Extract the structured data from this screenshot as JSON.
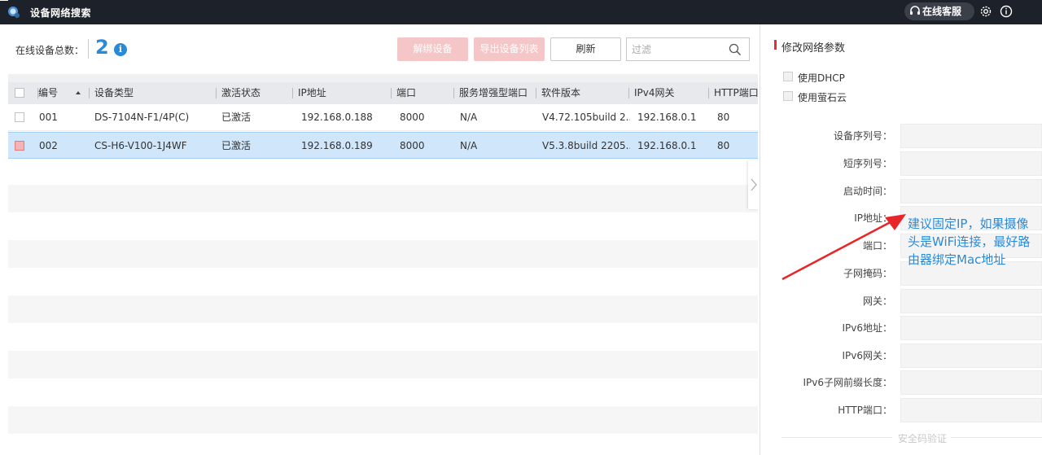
{
  "window": {
    "title": "设备网络搜索",
    "customer_service": "在线客服"
  },
  "toolbar": {
    "total_label": "在线设备总数：",
    "total_count": "2",
    "unbind_label": "解绑设备",
    "export_label": "导出设备列表",
    "refresh_label": "刷新",
    "filter_placeholder": "过滤"
  },
  "table": {
    "columns": [
      "编号",
      "设备类型",
      "激活状态",
      "IP地址",
      "端口",
      "服务增强型端口",
      "软件版本",
      "IPv4网关",
      "HTTP端口"
    ],
    "rows": [
      {
        "id": "001",
        "type": "DS-7104N-F1/4P(C)",
        "status": "已激活",
        "ip": "192.168.0.188",
        "port": "8000",
        "enhanced_port": "N/A",
        "version": "V4.72.105build 2...",
        "gateway": "192.168.0.1",
        "http_port": "80",
        "selected": false
      },
      {
        "id": "002",
        "type": "CS-H6-V100-1J4WF",
        "status": "已激活",
        "ip": "192.168.0.189",
        "port": "8000",
        "enhanced_port": "N/A",
        "version": "V5.3.8build 2205...",
        "gateway": "192.168.0.1",
        "http_port": "80",
        "selected": true
      }
    ]
  },
  "panel": {
    "title": "修改网络参数",
    "use_dhcp": "使用DHCP",
    "use_cloud": "使用萤石云",
    "fields": {
      "serial": "设备序列号：",
      "short_serial": "短序列号：",
      "start_time": "启动时间：",
      "ip": "IP地址：",
      "port": "端口：",
      "mask": "子网掩码：",
      "gateway": "网关：",
      "ipv6_addr": "IPv6地址：",
      "ipv6_gateway": "IPv6网关：",
      "ipv6_prefix": "IPv6子网前缀长度：",
      "http_port": "HTTP端口："
    },
    "verify_link": "安全码验证"
  },
  "annotation": {
    "text": "建议固定IP，如果摄像头是WiFi连接，最好路由器绑定Mac地址",
    "color": "#2a8ad8",
    "arrow_color": "#e8262a"
  },
  "colors": {
    "titlebar": "#1d2129",
    "accent_blue": "#2a8ad8",
    "disabled_red_button": "#f4c6c7",
    "selected_row": "#cfe6fb"
  }
}
